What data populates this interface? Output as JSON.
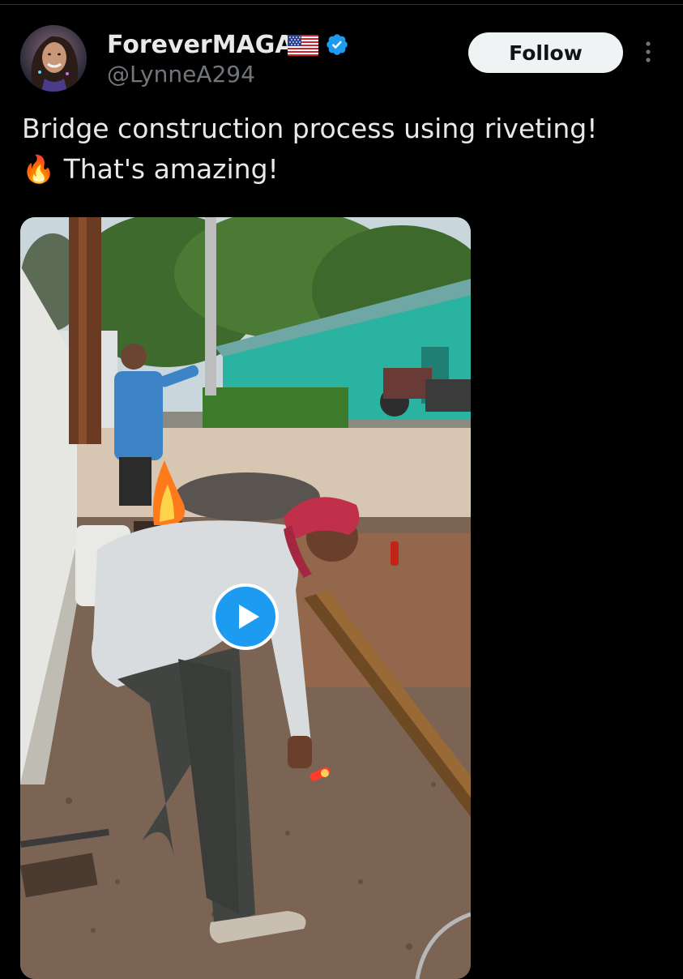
{
  "author": {
    "display_name": "ForeverMAGA",
    "flag_emoji": "🇺🇸",
    "handle": "@LynneA294",
    "verified": true,
    "verified_color": "#1d9bf0"
  },
  "actions": {
    "follow_label": "Follow",
    "more_icon": "more-vertical-icon"
  },
  "tweet": {
    "line1": "Bridge construction process using riveting!",
    "fire_emoji": "🔥",
    "line2": "That's amazing!"
  },
  "media": {
    "type": "video",
    "play_icon": "play-icon",
    "play_color": "#1d9bf0"
  },
  "colors": {
    "background": "#000000",
    "text": "#e7e9ea",
    "secondary_text": "#71767b",
    "accent": "#1d9bf0"
  }
}
